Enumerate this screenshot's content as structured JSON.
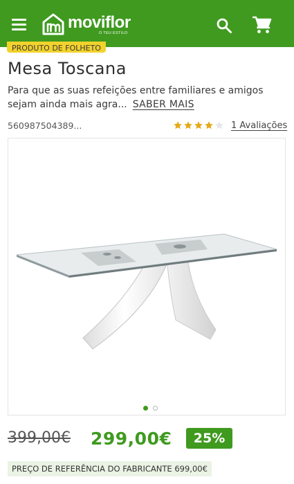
{
  "header": {
    "brand": "moviflor",
    "tagline": "O TEU ESTILO",
    "bg_color": "#3f9a1f",
    "icons": {
      "menu": "menu-icon",
      "search": "search-icon",
      "cart": "cart-icon"
    }
  },
  "badge": {
    "label": "PRODUTO DE FOLHETO",
    "color": "#f2d22c"
  },
  "product": {
    "title": "Mesa Toscana",
    "description": "Para que as suas refeições entre familiares e amigos sejam ainda mais agra...",
    "read_more": "SABER MAIS",
    "sku": "560987504389...",
    "rating": 4,
    "rating_max": 5,
    "reviews_label": "1 Avaliações"
  },
  "gallery": {
    "image_alt": "glass-top-table-white-x-base",
    "slides": 2,
    "active_slide": 1
  },
  "pricing": {
    "old_price": "399,00€",
    "new_price": "299,00€",
    "discount": "25%",
    "reference": "PREÇO DE REFERÊNCIA DO FABRICANTE 699,00€",
    "accent_color": "#3f9a1f"
  }
}
